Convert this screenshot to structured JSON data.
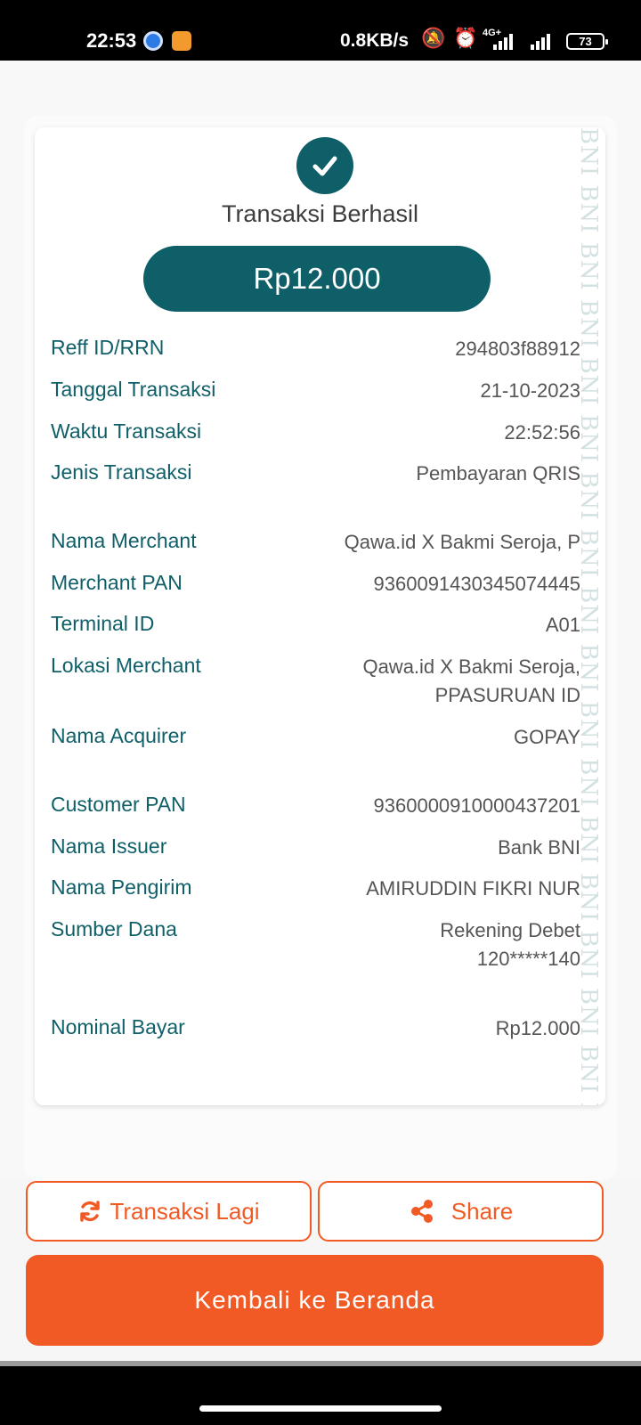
{
  "status_bar": {
    "time": "22:53",
    "net_speed": "0.8KB/s",
    "network_type": "4G+",
    "battery": "73"
  },
  "receipt": {
    "status": "Transaksi Berhasil",
    "amount": "Rp12.000",
    "watermark": "BNI BNI BNI BNI BNI BNI BNI BNI BNI BNI BNI BNI BNI BNI BNI BNI BNI BNI BNI BNI BNI BNI",
    "rows": [
      {
        "label": "Reff ID/RRN",
        "value": "294803f88912"
      },
      {
        "label": "Tanggal Transaksi",
        "value": "21-10-2023"
      },
      {
        "label": "Waktu Transaksi",
        "value": "22:52:56"
      },
      {
        "label": "Jenis Transaksi",
        "value": "Pembayaran QRIS"
      },
      {
        "label": "Nama Merchant",
        "value": "Qawa.id X Bakmi Seroja, P"
      },
      {
        "label": "Merchant PAN",
        "value": "9360091430345074445"
      },
      {
        "label": "Terminal ID",
        "value": "A01"
      },
      {
        "label": "Lokasi Merchant",
        "value_line1": "Qawa.id X Bakmi Seroja,",
        "value_line2": "PPASURUAN ID"
      },
      {
        "label": "Nama Acquirer",
        "value": "GOPAY"
      },
      {
        "label": "Customer PAN",
        "value": "9360000910000437201"
      },
      {
        "label": "Nama Issuer",
        "value": "Bank BNI"
      },
      {
        "label": "Nama Pengirim",
        "value": "AMIRUDDIN FIKRI NUR"
      },
      {
        "label": "Sumber Dana",
        "value_line1": "Rekening Debet",
        "value_line2": "120*****140"
      },
      {
        "label": "Nominal Bayar",
        "value": "Rp12.000"
      }
    ]
  },
  "actions": {
    "again_label": "Transaksi Lagi",
    "share_label": "Share",
    "home_label": "Kembali ke Beranda"
  },
  "colors": {
    "teal": "#0f5f69",
    "orange": "#f15a24"
  },
  "icons": {
    "again": "refresh-icon",
    "share": "share-icon",
    "status": "check-icon"
  }
}
